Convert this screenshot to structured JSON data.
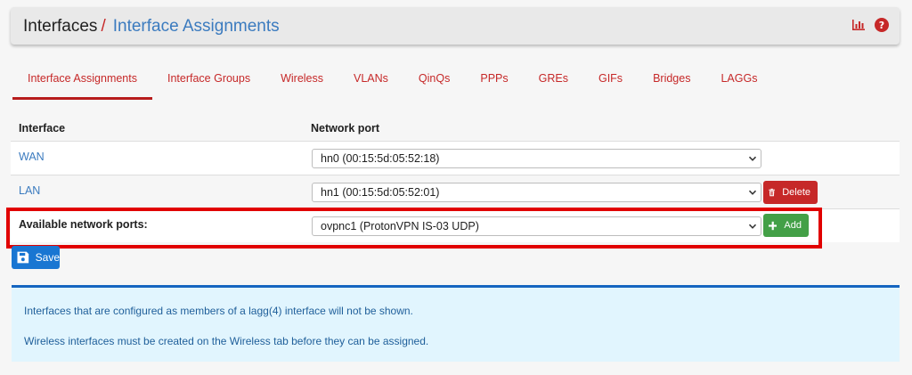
{
  "breadcrumb": {
    "part1": "Interfaces",
    "separator": "/",
    "part2": "Interface Assignments"
  },
  "header_icons": [
    "bar-chart-icon",
    "help-icon"
  ],
  "tabs": [
    {
      "label": "Interface Assignments",
      "active": true
    },
    {
      "label": "Interface Groups"
    },
    {
      "label": "Wireless"
    },
    {
      "label": "VLANs"
    },
    {
      "label": "QinQs"
    },
    {
      "label": "PPPs"
    },
    {
      "label": "GREs"
    },
    {
      "label": "GIFs"
    },
    {
      "label": "Bridges"
    },
    {
      "label": "LAGGs"
    }
  ],
  "table": {
    "headers": {
      "interface": "Interface",
      "port": "Network port"
    },
    "rows": [
      {
        "interface": "WAN",
        "port": "hn0 (00:15:5d:05:52:18)"
      },
      {
        "interface": "LAN",
        "port": "hn1 (00:15:5d:05:52:01)",
        "action": "Delete"
      }
    ],
    "available": {
      "label": "Available network ports:",
      "port": "ovpnc1 (ProtonVPN IS-03 UDP)",
      "action": "Add"
    }
  },
  "save_label": "Save",
  "info": {
    "line1": "Interfaces that are configured as members of a lagg(4) interface will not be shown.",
    "line2": "Wireless interfaces must be created on the Wireless tab before they can be assigned."
  },
  "colors": {
    "accent_red": "#c62828",
    "link_blue": "#3b7bbf",
    "success_green": "#43a047",
    "primary_blue": "#1976d2",
    "highlight": "#e10000",
    "info_bg": "#e1f5fe"
  }
}
